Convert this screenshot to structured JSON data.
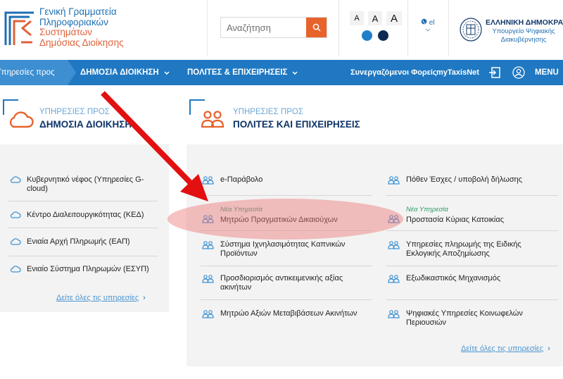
{
  "header": {
    "logo_lines": [
      "Γενική Γραμματεία",
      "Πληροφοριακών",
      "Συστημάτων",
      "Δημόσιας Διοίκησης"
    ],
    "search_placeholder": "Αναζήτηση",
    "font_sizes": [
      "A",
      "A",
      "A"
    ],
    "contrast_colors": [
      "#1f7fc7",
      "#0d2b52"
    ],
    "language": "el",
    "gov_title": "ΕΛΛΗΝΙΚΗ ΔΗΜΟΚΡΑΤΙΑ",
    "gov_ministry": "Υπουργείο Ψηφιακής Διακυβέρνησης"
  },
  "nav": {
    "breadcrumb": "Υπηρεσίες προς",
    "items": [
      "ΔΗΜΟΣΙΑ ΔΙΟΙΚΗΣΗ",
      "ΠΟΛΙΤΕΣ & ΕΠΙΧΕΙΡΗΣΕΙΣ"
    ],
    "links": [
      "Συνεργαζόμενοι Φορείς",
      "myTaxisNet"
    ],
    "menu_label": "MENU"
  },
  "left_section": {
    "subtitle": "ΥΠΗΡΕΣΙΕΣ ΠΡΟΣ",
    "title": "ΔΗΜΟΣΙΑ ΔΙΟΙΚΗΣΗ",
    "icon": "cloud-icon",
    "items": [
      "Κυβερνητικό νέφος (Υπηρεσίες G-cloud)",
      "Κέντρο Διαλειτουργικότητας (ΚΕΔ)",
      "Ενιαία Αρχή Πληρωμής (ΕΑΠ)",
      "Ενιαίο Σύστημα Πληρωμών (ΕΣΥΠ)"
    ],
    "see_all": "Δείτε όλες τις υπηρεσίες"
  },
  "right_section": {
    "subtitle": "ΥΠΗΡΕΣΙΕΣ ΠΡΟΣ",
    "title": "ΠΟΛΙΤΕΣ ΚΑΙ ΕΠΙΧΕΙΡΗΣΕΙΣ",
    "icon": "people-icon",
    "new_badge": "Νέα Υπηρεσία",
    "col1": [
      "e-Παράβολο",
      "Μητρώο Πραγματικών Δικαιούχων",
      "Σύστημα Ιχνηλασιμότητας Καπνικών Προϊόντων",
      "Προσδιορισμός αντικειμενικής αξίας ακινήτων",
      "Μητρώο Αξιών Μεταβιβάσεων Ακινήτων"
    ],
    "col2": [
      "Πόθεν Έσχες / υποβολή δήλωσης",
      "Προστασία Κύριας Κατοικίας",
      "Υπηρεσίες πληρωμής της Ειδικής Εκλογικής Αποζημίωσης",
      "Εξωδικαστικός Μηχανισμός",
      "Ψηφιακές Υπηρεσίες Κοινωφελών Περιουσιών"
    ],
    "see_all": "Δείτε όλες τις υπηρεσίες"
  },
  "colors": {
    "brand_blue": "#1f78c1",
    "accent_orange": "#e8622c",
    "panel_bg": "#f3f3f3",
    "highlight": "#ed7878",
    "arrow": "#e21010"
  }
}
